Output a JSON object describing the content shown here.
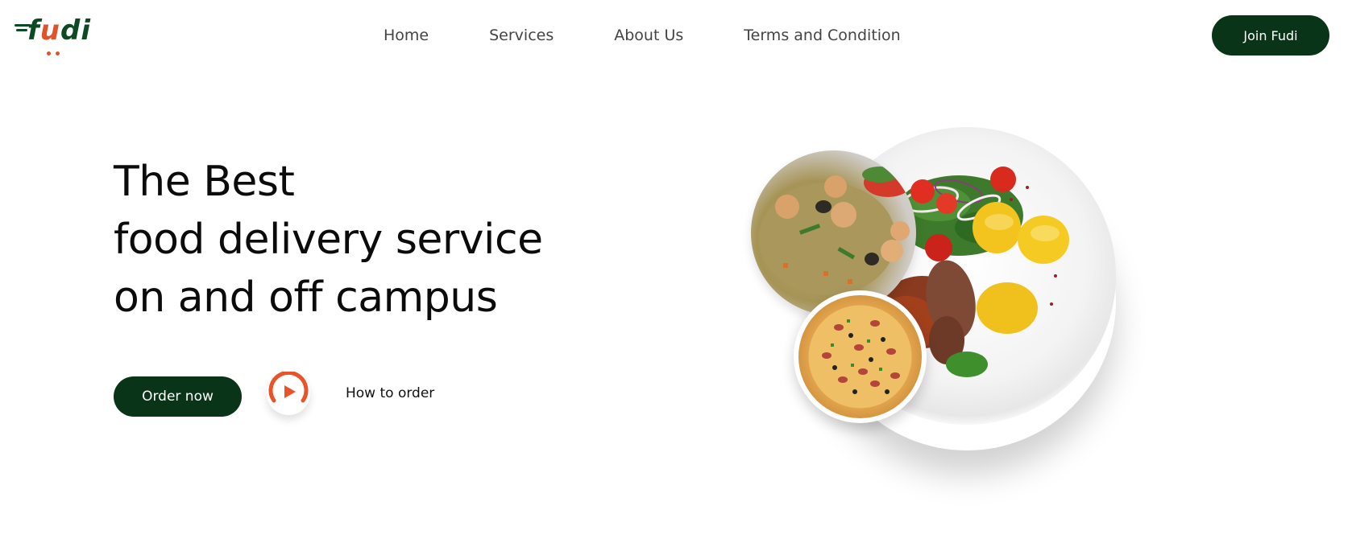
{
  "brand": {
    "logo_text_1": "f",
    "logo_text_u": "u",
    "logo_text_2": "di",
    "primary_color": "#0a3417",
    "accent_color": "#e0532a"
  },
  "nav": {
    "items": [
      {
        "label": "Home"
      },
      {
        "label": "Services"
      },
      {
        "label": "About Us"
      },
      {
        "label": "Terms and Condition"
      }
    ],
    "join_label": "Join Fudi"
  },
  "hero": {
    "title_lines": [
      "The Best",
      "food delivery service",
      "on and off campus"
    ],
    "order_label": "Order now",
    "howto_label": "How to order",
    "play_icon": "play-icon"
  }
}
